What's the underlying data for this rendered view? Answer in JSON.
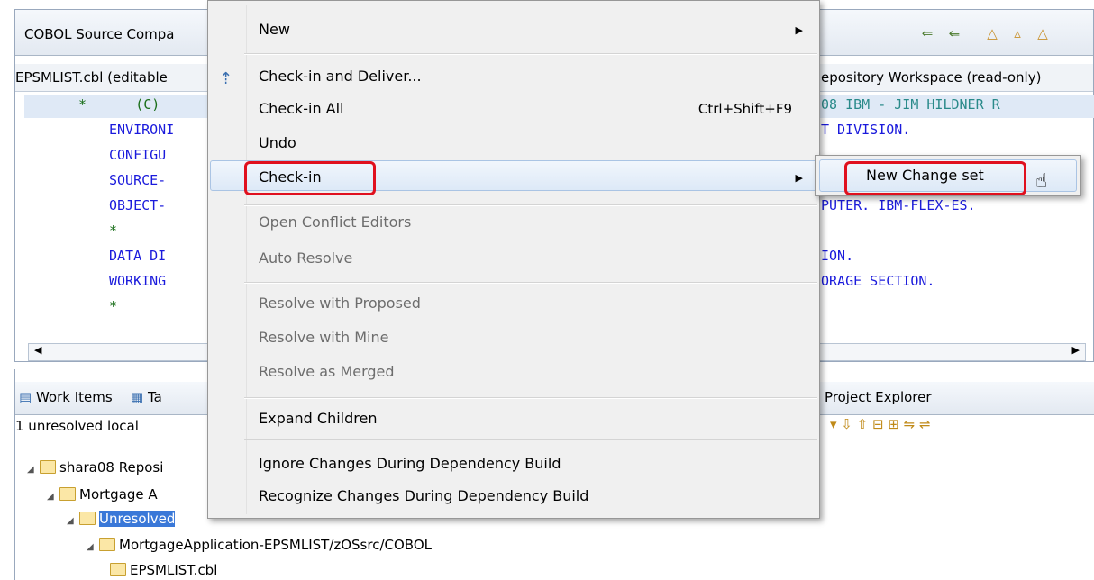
{
  "editor": {
    "tab_title": "COBOL Source Compa",
    "left_header": "EPSMLIST.cbl (editable",
    "right_header": "epository Workspace (read-only)",
    "left_lines": [
      {
        "text": "*      (C)",
        "kind": "star"
      },
      {
        "text": "ENVIRONI",
        "kind": "code"
      },
      {
        "text": "CONFIGU",
        "kind": "code"
      },
      {
        "text": "SOURCE-",
        "kind": "code"
      },
      {
        "text": "OBJECT-",
        "kind": "code"
      },
      {
        "text": "*",
        "kind": "star"
      },
      {
        "text": "DATA DI",
        "kind": "code"
      },
      {
        "text": "WORKING",
        "kind": "code"
      },
      {
        "text": "*",
        "kind": "star"
      }
    ],
    "right_lines": [
      {
        "text": "08 IBM - JIM HILDNER R",
        "kind": "comment"
      },
      {
        "text": "T DIVISION.",
        "kind": "code"
      },
      {
        "text": "PUTER. IBM-FLEX-ES.",
        "kind": "code"
      },
      {
        "text": "ION.",
        "kind": "code"
      },
      {
        "text": "ORAGE SECTION.",
        "kind": "code"
      }
    ]
  },
  "bottom": {
    "tabs": [
      "Work Items",
      "Ta",
      "Project Explorer"
    ],
    "status": "1 unresolved local",
    "tree": [
      {
        "label": "shara08 Reposi",
        "level": 0
      },
      {
        "label": "Mortgage A",
        "level": 1
      },
      {
        "label": "Unresolved",
        "level": 2
      },
      {
        "label": "MortgageApplication-EPSMLIST/zOSsrc/COBOL",
        "level": 3
      },
      {
        "label": "EPSMLIST.cbl",
        "level": 4
      }
    ]
  },
  "menu": {
    "items": [
      {
        "label": "New",
        "submenu": true,
        "disabled": false
      },
      {
        "label": "Check-in and Deliver...",
        "disabled": false
      },
      {
        "label": "Check-in All",
        "shortcut": "Ctrl+Shift+F9",
        "disabled": false
      },
      {
        "label": "Undo",
        "disabled": false
      },
      {
        "label": "Check-in",
        "submenu": true,
        "disabled": false
      },
      {
        "label": "Open Conflict Editors",
        "disabled": true
      },
      {
        "label": "Auto Resolve",
        "disabled": true
      },
      {
        "label": "Resolve with Proposed",
        "disabled": true
      },
      {
        "label": "Resolve with Mine",
        "disabled": true
      },
      {
        "label": "Resolve as Merged",
        "disabled": true
      },
      {
        "label": "Expand Children",
        "disabled": false
      },
      {
        "label": "Ignore Changes During Dependency Build",
        "disabled": false
      },
      {
        "label": "Recognize Changes During Dependency Build",
        "disabled": false
      }
    ],
    "submenu_item": "New Change set"
  },
  "colors": {
    "highlight_red": "#e0101e",
    "code_blue": "#1a1adc"
  }
}
